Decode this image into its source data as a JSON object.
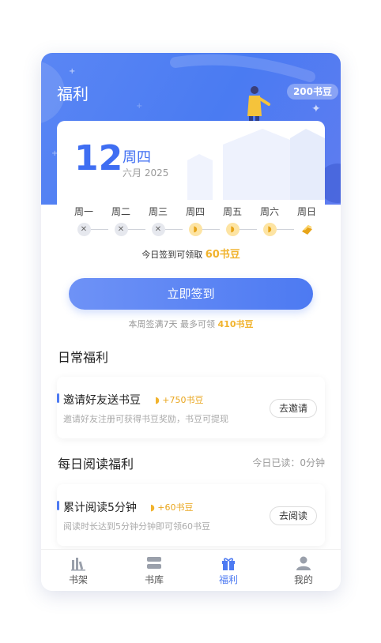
{
  "header": {
    "title": "福利",
    "badge": "200书豆"
  },
  "date_card": {
    "day": "12",
    "weekday": "周四",
    "month_year": "六月 2025"
  },
  "week": [
    {
      "label": "周一",
      "state": "missed",
      "icon": "close-icon"
    },
    {
      "label": "周二",
      "state": "missed",
      "icon": "close-icon"
    },
    {
      "label": "周三",
      "state": "missed",
      "icon": "close-icon"
    },
    {
      "label": "周四",
      "state": "coin",
      "icon": "bean-coin-icon"
    },
    {
      "label": "周五",
      "state": "coin",
      "icon": "bean-coin-icon"
    },
    {
      "label": "周六",
      "state": "coin",
      "icon": "bean-coin-icon"
    },
    {
      "label": "周日",
      "state": "gift",
      "icon": "bean-pile-icon"
    }
  ],
  "today_tip": {
    "prefix": "今日签到可领取",
    "amount": "60书豆"
  },
  "signin_button": "立即签到",
  "week_tip": {
    "prefix": "本周签满7天 最多可领",
    "amount": "410书豆"
  },
  "daily_section": {
    "title": "日常福利",
    "tasks": [
      {
        "name": "邀请好友送书豆",
        "reward": "+750书豆",
        "desc": "邀请好友注册可获得书豆奖励，书豆可提现",
        "action": "去邀请"
      }
    ]
  },
  "reading_section": {
    "title": "每日阅读福利",
    "meta": "今日已读：0分钟",
    "tasks": [
      {
        "name": "累计阅读5分钟",
        "reward": "+60书豆",
        "desc": "阅读时长达到5分钟分钟即可领60书豆",
        "action": "去阅读"
      }
    ]
  },
  "tabs": [
    {
      "label": "书架",
      "icon": "bookshelf-icon",
      "active": false
    },
    {
      "label": "书库",
      "icon": "library-icon",
      "active": false
    },
    {
      "label": "福利",
      "icon": "gift-icon",
      "active": true
    },
    {
      "label": "我的",
      "icon": "user-icon",
      "active": false
    }
  ],
  "colors": {
    "accent": "#4d7af2",
    "gold": "#f1b32d"
  }
}
